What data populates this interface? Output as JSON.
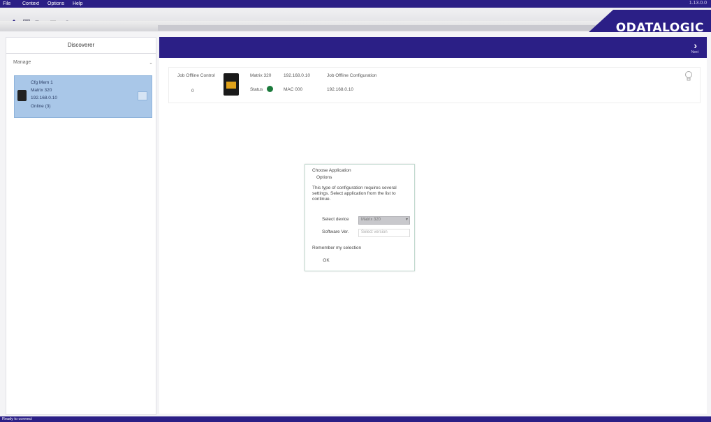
{
  "menu": {
    "items": [
      "File",
      "Context",
      "Options",
      "Help"
    ],
    "right_text": "1.13.0.0"
  },
  "toolbar": {
    "icons": [
      "home-icon",
      "save-icon",
      "open-icon",
      "list-icon",
      "help-icon"
    ]
  },
  "brand": {
    "logo": "ODATALOGIC"
  },
  "left_panel": {
    "tab_label": "Discoverer",
    "filter_label": "Manage",
    "device": {
      "name": "Cfg Mem 1",
      "model": "Matrix 320",
      "ip": "192.168.0.10",
      "status": "Online (3)"
    }
  },
  "header": {
    "next_label": "Next"
  },
  "info_strip": {
    "col1_label": "Job Offline Control",
    "col1_value": "0",
    "model_label": "Matrix 320",
    "status_label": "Status",
    "ip_label": "192.168.0.10",
    "mac_label": "MAC 000",
    "job_label": "Job Offline Configuration",
    "job_value": "192.168.0.10"
  },
  "dialog": {
    "title": "Choose Application",
    "subtitle": "Options",
    "description": "This type of configuration requires several settings. Select application from the list to continue.",
    "select_label": "Select device",
    "select_value": "Matrix 320",
    "sfw_label": "Software Ver.",
    "sfw_placeholder": "Select version",
    "checkbox_label": "Remember my selection",
    "ok_label": "OK"
  },
  "status_bar": {
    "text": "Ready to connect"
  },
  "colors": {
    "brand_purple": "#2b1f86",
    "selection_blue": "#a9c7e8",
    "status_green": "#1b7a3b"
  }
}
